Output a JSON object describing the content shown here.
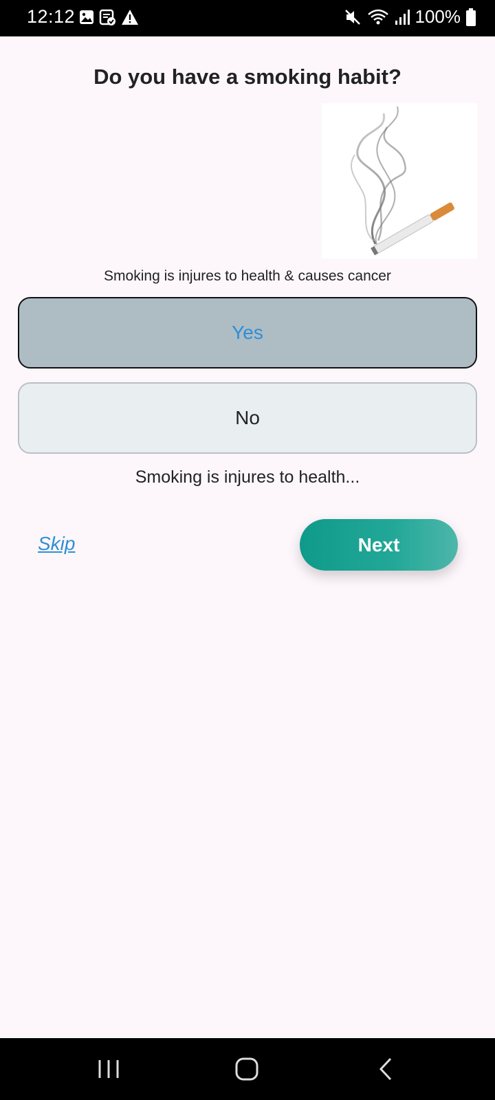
{
  "status_bar": {
    "time": "12:12",
    "battery": "100%",
    "left_icons": [
      "image-icon",
      "calendar-check-icon",
      "warning-icon"
    ],
    "right_icons": [
      "mute-icon",
      "wifi-icon",
      "signal-icon",
      "battery-icon"
    ]
  },
  "question": {
    "title": "Do you have a smoking habit?",
    "illustration": "cigarette-smoke-image",
    "warning": "Smoking is injures to health & causes cancer"
  },
  "options": [
    {
      "label": "Yes",
      "selected": true
    },
    {
      "label": "No",
      "selected": false
    }
  ],
  "hint": "Smoking is injures to health...",
  "actions": {
    "skip_label": "Skip",
    "next_label": "Next"
  },
  "colors": {
    "accent": "#2e8fd6",
    "next_gradient_start": "#0f9a8a",
    "next_gradient_end": "#4db6aa",
    "selected_option_bg": "#aebcc4",
    "unselected_option_bg": "#e9eef1"
  },
  "nav_bar": [
    "recents-icon",
    "home-icon",
    "back-icon"
  ]
}
